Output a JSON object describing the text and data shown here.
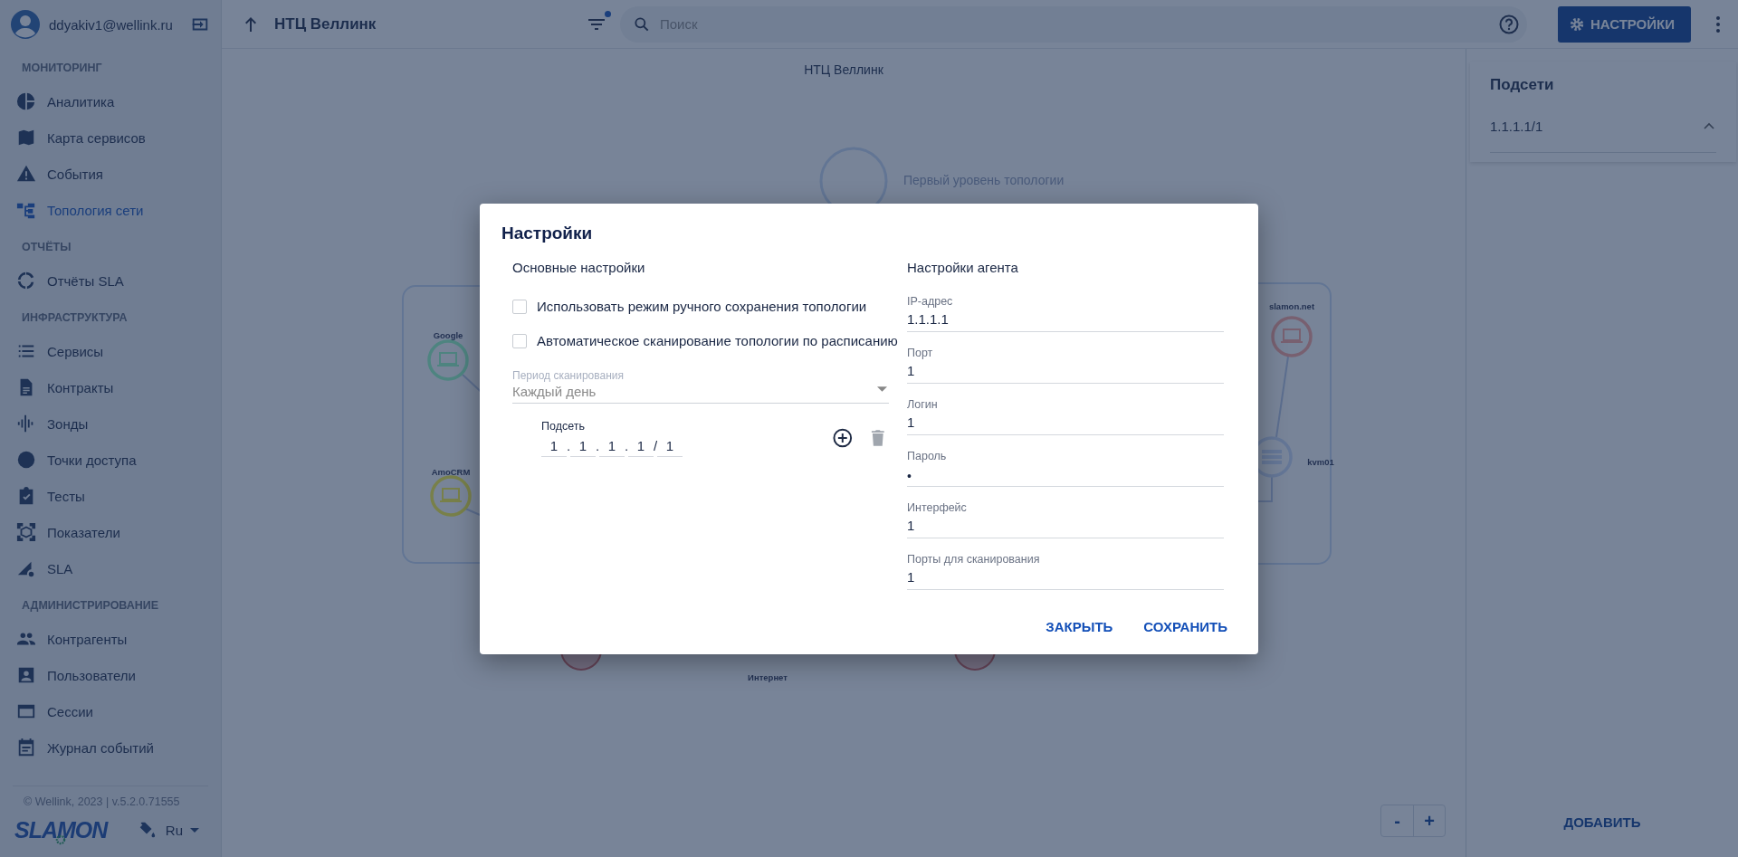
{
  "user": {
    "email": "ddyakiv1@wellink.ru"
  },
  "sidebar": {
    "sections": [
      {
        "title": "МОНИТОРИНГ",
        "items": [
          {
            "label": "Аналитика",
            "selected": false
          },
          {
            "label": "Карта сервисов",
            "selected": false
          },
          {
            "label": "События",
            "selected": false
          },
          {
            "label": "Топология сети",
            "selected": true
          }
        ]
      },
      {
        "title": "ОТЧЁТЫ",
        "items": [
          {
            "label": "Отчёты SLA",
            "selected": false
          }
        ]
      },
      {
        "title": "ИНФРАСТРУКТУРА",
        "items": [
          {
            "label": "Сервисы",
            "selected": false
          },
          {
            "label": "Контракты",
            "selected": false
          },
          {
            "label": "Зонды",
            "selected": false
          },
          {
            "label": "Точки доступа",
            "selected": false
          },
          {
            "label": "Тесты",
            "selected": false
          },
          {
            "label": "Показатели",
            "selected": false
          },
          {
            "label": "SLA",
            "selected": false
          }
        ]
      },
      {
        "title": "АДМИНИСТРИРОВАНИЕ",
        "items": [
          {
            "label": "Контрагенты",
            "selected": false
          },
          {
            "label": "Пользователи",
            "selected": false
          },
          {
            "label": "Сессии",
            "selected": false
          },
          {
            "label": "Журнал событий",
            "selected": false
          }
        ]
      }
    ],
    "footer": "© Wellink, 2023 | v.5.2.0.71555",
    "logo": "SLAMON",
    "language": "Ru"
  },
  "topbar": {
    "title": "НТЦ Веллинк",
    "filter_active": true,
    "search": {
      "placeholder": "Поиск"
    },
    "settings_button": "НАСТРОЙКИ"
  },
  "canvas": {
    "title": "НТЦ Веллинк",
    "level_label": "Первый уровень топологии",
    "nodes": [
      {
        "label": "Google",
        "kind": "host",
        "color": "#4e8480"
      },
      {
        "label": "AmoCRM",
        "kind": "host",
        "color": "#78804a"
      },
      {
        "label": "slamon.net",
        "kind": "host",
        "color": "#786070"
      },
      {
        "label": "kvm01",
        "kind": "server",
        "color": "#647696"
      }
    ],
    "internet_label": "Интернет",
    "zoom_buttons": [
      "-",
      "+"
    ]
  },
  "subnets_panel": {
    "title": "Подсети",
    "items": [
      {
        "label": "1.1.1.1/1",
        "expanded": true
      }
    ],
    "add_button": "ДОБАВИТЬ"
  },
  "dialog": {
    "title": "Настройки",
    "main": {
      "heading": "Основные настройки",
      "checkboxes": [
        {
          "label": "Использовать режим ручного сохранения топологии",
          "checked": false
        },
        {
          "label": "Автоматическое сканирование топологии по расписанию",
          "checked": false
        }
      ],
      "period": {
        "label": "Период сканирования",
        "value": "Каждый день",
        "disabled": true
      },
      "subnet": {
        "label": "Подсеть",
        "parts": [
          {
            "value": "1",
            "sep": "."
          },
          {
            "value": "1",
            "sep": "."
          },
          {
            "value": "1",
            "sep": "."
          },
          {
            "value": "1",
            "sep": "/"
          },
          {
            "value": "1"
          }
        ]
      }
    },
    "agent": {
      "heading": "Настройки агента",
      "fields": [
        {
          "label": "IP-адрес",
          "value": "1.1.1.1",
          "kind": "text"
        },
        {
          "label": "Порт",
          "value": "1",
          "kind": "text"
        },
        {
          "label": "Логин",
          "value": "1",
          "kind": "text"
        },
        {
          "label": "Пароль",
          "value": "•",
          "kind": "password"
        },
        {
          "label": "Интерфейс",
          "value": "1",
          "kind": "text"
        },
        {
          "label": "Порты для сканирования",
          "value": "1",
          "kind": "text"
        }
      ]
    },
    "actions": [
      "ЗАКРЫТЬ",
      "СОХРАНИТЬ"
    ]
  }
}
